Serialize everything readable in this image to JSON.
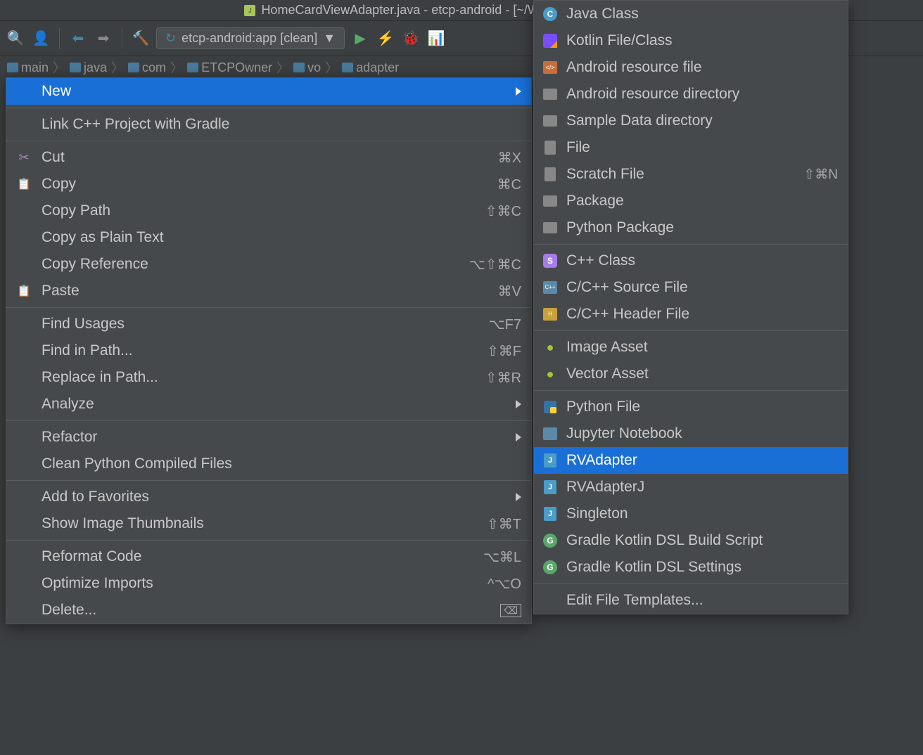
{
  "titlebar": {
    "filename": "HomeCardViewAdapter.java",
    "project": "etcp-android",
    "path": "[~/Work/Project/GitCode/ETC"
  },
  "toolbar": {
    "run_config": "etcp-android:app [clean]"
  },
  "breadcrumb": {
    "items": [
      "main",
      "java",
      "com",
      "ETCPOwner",
      "vo",
      "adapter"
    ]
  },
  "context_menu": {
    "groups": [
      [
        {
          "label": "New",
          "submenu": true,
          "highlighted": true
        }
      ],
      [
        {
          "label": "Link C++ Project with Gradle"
        }
      ],
      [
        {
          "label": "Cut",
          "shortcut": "⌘X",
          "icon": "scissors"
        },
        {
          "label": "Copy",
          "shortcut": "⌘C",
          "icon": "clipboard"
        },
        {
          "label": "Copy Path",
          "shortcut": "⇧⌘C"
        },
        {
          "label": "Copy as Plain Text"
        },
        {
          "label": "Copy Reference",
          "shortcut": "⌥⇧⌘C"
        },
        {
          "label": "Paste",
          "shortcut": "⌘V",
          "icon": "clipboard"
        }
      ],
      [
        {
          "label": "Find Usages",
          "shortcut": "⌥F7"
        },
        {
          "label": "Find in Path...",
          "shortcut": "⇧⌘F"
        },
        {
          "label": "Replace in Path...",
          "shortcut": "⇧⌘R"
        },
        {
          "label": "Analyze",
          "submenu": true
        }
      ],
      [
        {
          "label": "Refactor",
          "submenu": true
        },
        {
          "label": "Clean Python Compiled Files"
        }
      ],
      [
        {
          "label": "Add to Favorites",
          "submenu": true
        },
        {
          "label": "Show Image Thumbnails",
          "shortcut": "⇧⌘T"
        }
      ],
      [
        {
          "label": "Reformat Code",
          "shortcut": "⌥⌘L"
        },
        {
          "label": "Optimize Imports",
          "shortcut": "^⌥O"
        },
        {
          "label": "Delete...",
          "delete_icon": true
        }
      ]
    ]
  },
  "submenu": {
    "groups": [
      [
        {
          "label": "Java Class",
          "icon": "c",
          "icon_text": "C"
        },
        {
          "label": "Kotlin File/Class",
          "icon": "k"
        },
        {
          "label": "Android resource file",
          "icon": "xml",
          "icon_text": "</>"
        },
        {
          "label": "Android resource directory",
          "icon": "folder"
        },
        {
          "label": "Sample Data directory",
          "icon": "folder"
        },
        {
          "label": "File",
          "icon": "file"
        },
        {
          "label": "Scratch File",
          "icon": "file",
          "shortcut": "⇧⌘N"
        },
        {
          "label": "Package",
          "icon": "folder"
        },
        {
          "label": "Python Package",
          "icon": "folder"
        }
      ],
      [
        {
          "label": "C++ Class",
          "icon": "s",
          "icon_text": "S"
        },
        {
          "label": "C/C++ Source File",
          "icon": "cpp",
          "icon_text": "C++"
        },
        {
          "label": "C/C++ Header File",
          "icon": "h",
          "icon_text": "H"
        }
      ],
      [
        {
          "label": "Image Asset",
          "icon": "android"
        },
        {
          "label": "Vector Asset",
          "icon": "android"
        }
      ],
      [
        {
          "label": "Python File",
          "icon": "py"
        },
        {
          "label": "Jupyter Notebook",
          "icon": "jup"
        },
        {
          "label": "RVAdapter",
          "icon": "j",
          "icon_text": "J",
          "highlighted": true
        },
        {
          "label": "RVAdapterJ",
          "icon": "j",
          "icon_text": "J"
        },
        {
          "label": "Singleton",
          "icon": "j",
          "icon_text": "J"
        },
        {
          "label": "Gradle Kotlin DSL Build Script",
          "icon": "g",
          "icon_text": "G"
        },
        {
          "label": "Gradle Kotlin DSL Settings",
          "icon": "g",
          "icon_text": "G"
        }
      ],
      [
        {
          "label": "Edit File Templates..."
        }
      ]
    ]
  }
}
